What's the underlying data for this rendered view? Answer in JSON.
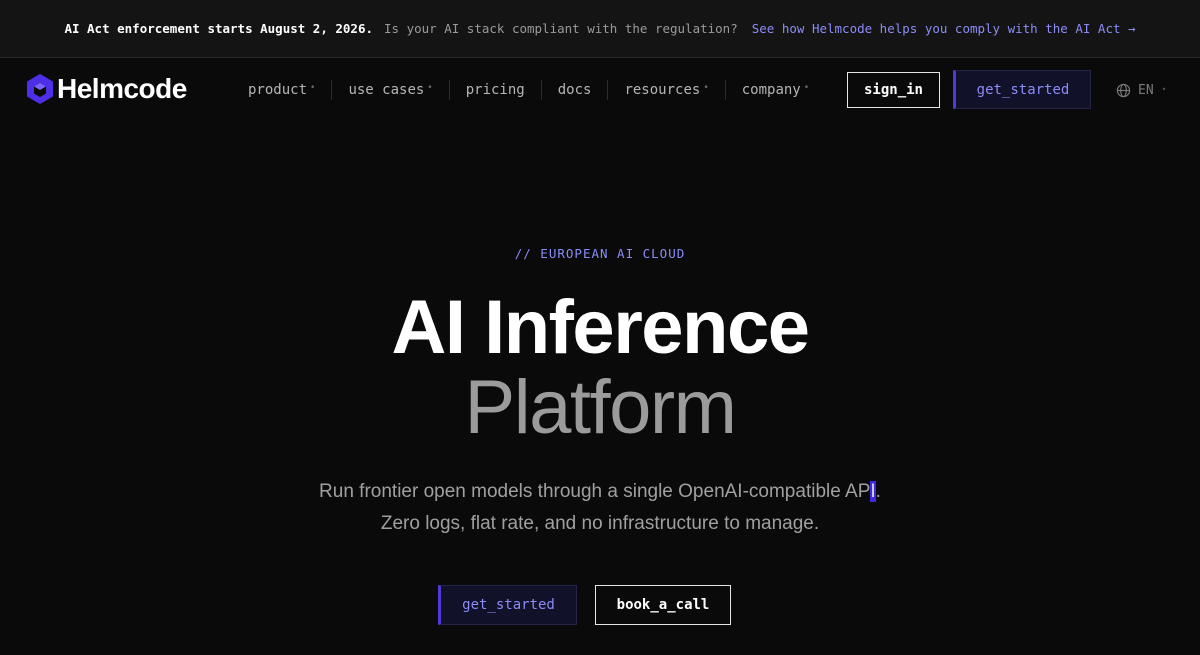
{
  "announcement": {
    "headline": "AI Act enforcement starts August 2, 2026.",
    "question": "Is your AI stack compliant with the regulation?",
    "link_text": "See how Helmcode helps you comply with the AI Act →"
  },
  "nav": {
    "logo_text": "Helmcode",
    "logo_icon": "hexagon-cube-icon",
    "menu": [
      {
        "label": "product",
        "has_dropdown": true
      },
      {
        "label": "use cases",
        "has_dropdown": true
      },
      {
        "label": "pricing",
        "has_dropdown": false
      },
      {
        "label": "docs",
        "has_dropdown": false
      },
      {
        "label": "resources",
        "has_dropdown": true
      },
      {
        "label": "company",
        "has_dropdown": true
      }
    ],
    "dropdown_marker": "•",
    "sign_in": "sign_in",
    "get_started": "get_started",
    "language": "EN",
    "language_icon": "globe-icon"
  },
  "hero": {
    "eyebrow": "// EUROPEAN AI CLOUD",
    "title_line1": "AI Inference",
    "title_line2": "Platform",
    "subtitle_line1_pre": "Run frontier open models through a single OpenAI-compatible AP",
    "subtitle_line1_cursor": "I",
    "subtitle_line1_post": ".",
    "subtitle_line2": "Zero logs, flat rate, and no infrastructure to manage.",
    "primary_cta": "get_started",
    "secondary_cta": "book_a_call"
  },
  "colors": {
    "background": "#0a0a0a",
    "accent": "#8b8cf6",
    "accent_border": "#4f3bd9",
    "logo": "#4f2ee8",
    "selection": "#4127e0"
  }
}
